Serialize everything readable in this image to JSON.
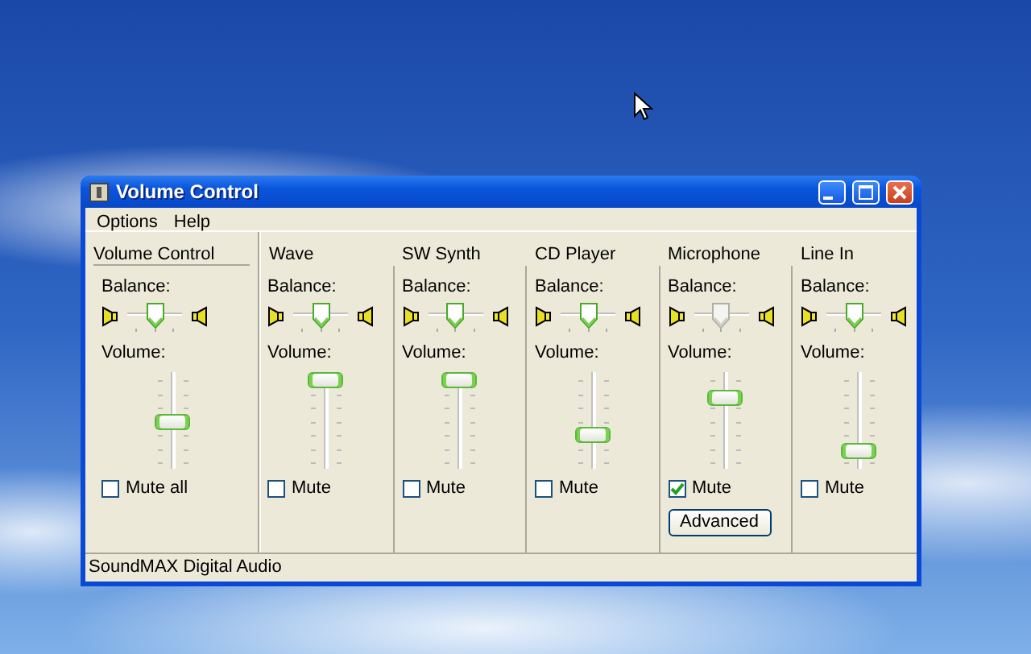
{
  "window": {
    "title": "Volume Control"
  },
  "menu": [
    "Options",
    "Help"
  ],
  "channels": [
    {
      "name": "Volume Control",
      "kind": "master",
      "balance_label": "Balance:",
      "balance": {
        "level": 0.5,
        "disabled": false
      },
      "volume_label": "Volume:",
      "volume": {
        "level": 0.5
      },
      "mute_label": "Mute all",
      "muted": false
    },
    {
      "name": "Wave",
      "kind": "channel",
      "balance_label": "Balance:",
      "balance": {
        "level": 0.5,
        "disabled": false
      },
      "volume_label": "Volume:",
      "volume": {
        "level": 1.0
      },
      "mute_label": "Mute",
      "muted": false
    },
    {
      "name": "SW Synth",
      "kind": "channel",
      "balance_label": "Balance:",
      "balance": {
        "level": 0.5,
        "disabled": false
      },
      "volume_label": "Volume:",
      "volume": {
        "level": 1.0
      },
      "mute_label": "Mute",
      "muted": false
    },
    {
      "name": "CD Player",
      "kind": "channel",
      "balance_label": "Balance:",
      "balance": {
        "level": 0.5,
        "disabled": false
      },
      "volume_label": "Volume:",
      "volume": {
        "level": 0.35
      },
      "mute_label": "Mute",
      "muted": false
    },
    {
      "name": "Microphone",
      "kind": "channel",
      "balance_label": "Balance:",
      "balance": {
        "level": 0.5,
        "disabled": true
      },
      "volume_label": "Volume:",
      "volume": {
        "level": 0.78
      },
      "mute_label": "Mute",
      "muted": true,
      "button": "Advanced"
    },
    {
      "name": "Line In",
      "kind": "channel",
      "balance_label": "Balance:",
      "balance": {
        "level": 0.5,
        "disabled": false
      },
      "volume_label": "Volume:",
      "volume": {
        "level": 0.15
      },
      "mute_label": "Mute",
      "muted": false
    }
  ],
  "status_bar": "SoundMAX Digital Audio"
}
